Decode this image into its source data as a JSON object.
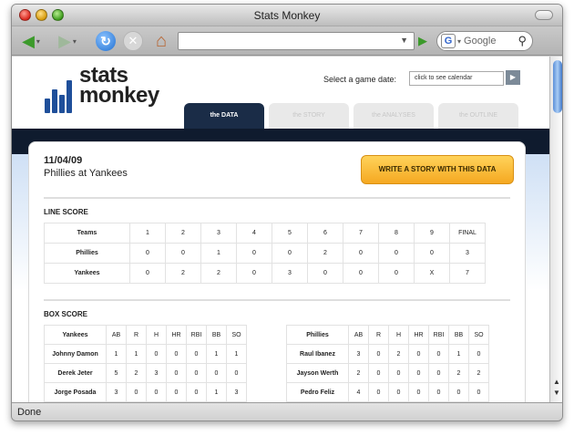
{
  "window": {
    "title": "Stats Monkey"
  },
  "browser": {
    "search_placeholder": "Google",
    "status": "Done"
  },
  "site": {
    "logo_line1": "stats",
    "logo_line2": "monkey",
    "date_label": "Select a game date:",
    "date_placeholder": "click to see calendar",
    "tabs": [
      {
        "label": "the DATA",
        "active": true
      },
      {
        "label": "the STORY",
        "active": false
      },
      {
        "label": "the ANALYSES",
        "active": false
      },
      {
        "label": "the OUTLINE",
        "active": false
      }
    ]
  },
  "game": {
    "date": "11/04/09",
    "matchup": "Phillies at Yankees",
    "write_button": "WRITE A STORY WITH THIS DATA"
  },
  "line_score": {
    "title": "LINE SCORE",
    "headers": [
      "Teams",
      "1",
      "2",
      "3",
      "4",
      "5",
      "6",
      "7",
      "8",
      "9",
      "FINAL"
    ],
    "rows": [
      [
        "Phillies",
        "0",
        "0",
        "1",
        "0",
        "0",
        "2",
        "0",
        "0",
        "0",
        "3"
      ],
      [
        "Yankees",
        "0",
        "2",
        "2",
        "0",
        "3",
        "0",
        "0",
        "0",
        "X",
        "7"
      ]
    ]
  },
  "box_score": {
    "title": "BOX SCORE",
    "yankees": {
      "headers": [
        "Yankees",
        "AB",
        "R",
        "H",
        "HR",
        "RBI",
        "BB",
        "SO"
      ],
      "rows": [
        [
          "Johnny Damon",
          "1",
          "1",
          "0",
          "0",
          "0",
          "1",
          "1"
        ],
        [
          "Derek Jeter",
          "5",
          "2",
          "3",
          "0",
          "0",
          "0",
          "0"
        ],
        [
          "Jorge Posada",
          "3",
          "0",
          "0",
          "0",
          "0",
          "1",
          "3"
        ]
      ]
    },
    "phillies": {
      "headers": [
        "Phillies",
        "AB",
        "R",
        "H",
        "HR",
        "RBI",
        "BB",
        "SO"
      ],
      "rows": [
        [
          "Raul Ibanez",
          "3",
          "0",
          "2",
          "0",
          "0",
          "1",
          "0"
        ],
        [
          "Jayson Werth",
          "2",
          "0",
          "0",
          "0",
          "0",
          "2",
          "2"
        ],
        [
          "Pedro Feliz",
          "4",
          "0",
          "0",
          "0",
          "0",
          "0",
          "0"
        ]
      ]
    }
  }
}
